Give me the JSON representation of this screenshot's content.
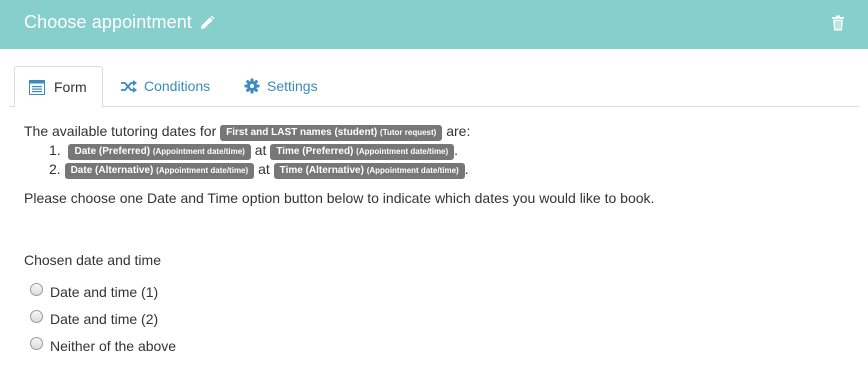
{
  "header": {
    "title": "Choose appointment",
    "color": "#86cfcd"
  },
  "tabs": [
    {
      "label": "Form",
      "icon": "form-icon",
      "active": true
    },
    {
      "label": "Conditions",
      "icon": "shuffle-icon",
      "active": false
    },
    {
      "label": "Settings",
      "icon": "gear-icon",
      "active": false
    }
  ],
  "content": {
    "intro_prefix": "The available tutoring dates for",
    "intro_badge_main": "First and LAST names (student)",
    "intro_badge_sub": "(Tutor request)",
    "intro_suffix": "are:",
    "items": [
      {
        "number": "1.",
        "date_main": "Date (Preferred)",
        "date_sub": "(Appointment date/time)",
        "at": "at",
        "time_main": "Time (Preferred)",
        "time_sub": "(Appointment date/time)",
        "end": "."
      },
      {
        "number": "2.",
        "date_main": "Date (Alternative)",
        "date_sub": "(Appointment date/time)",
        "at": "at",
        "time_main": "Time (Alternative)",
        "time_sub": "(Appointment date/time)",
        "end": "."
      }
    ],
    "instruction": "Please choose one Date and Time option button below to indicate which dates you would like to book."
  },
  "question": {
    "label": "Chosen date and time",
    "options": [
      "Date and time (1)",
      "Date and time (2)",
      "Neither of the above"
    ]
  }
}
